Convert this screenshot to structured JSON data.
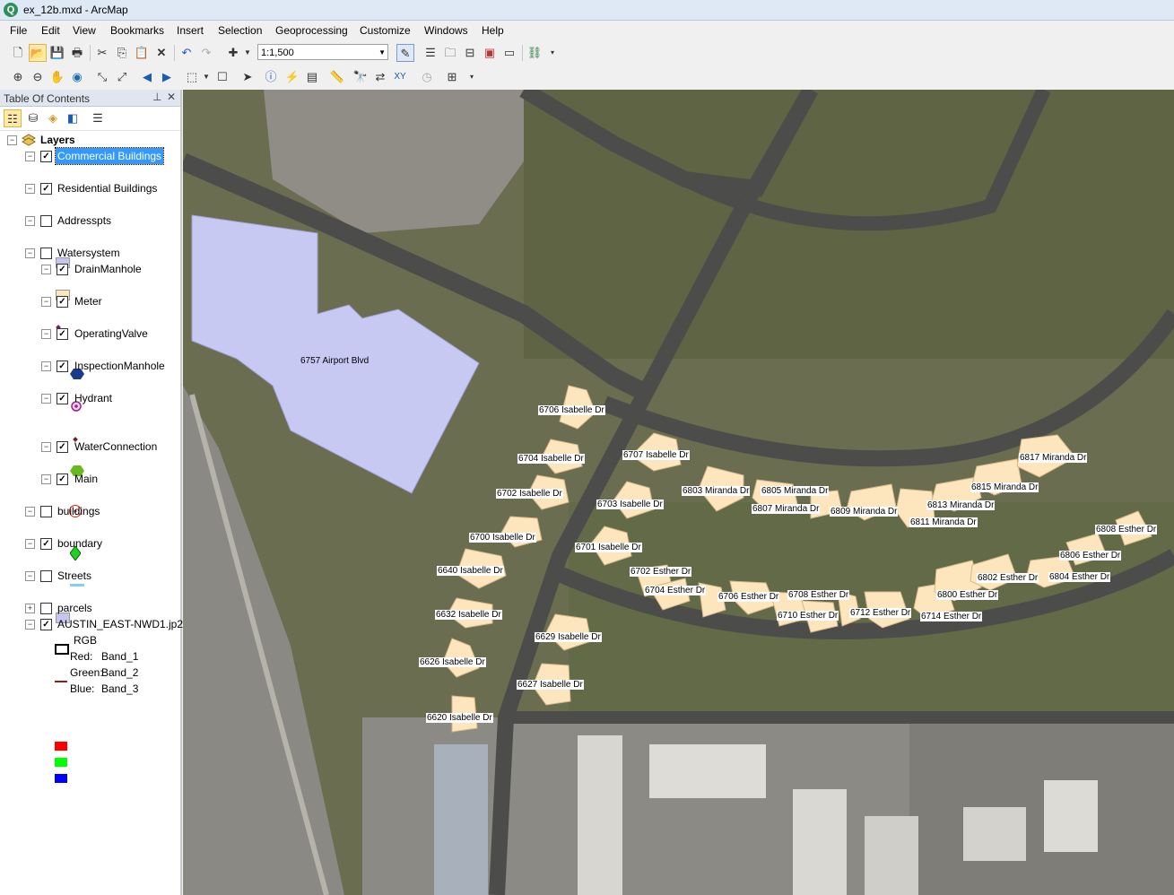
{
  "window": {
    "title": "ex_12b.mxd - ArcMap"
  },
  "menu": [
    "File",
    "Edit",
    "View",
    "Bookmarks",
    "Insert",
    "Selection",
    "Geoprocessing",
    "Customize",
    "Windows",
    "Help"
  ],
  "toolbar": {
    "scale": "1:1,500"
  },
  "toc": {
    "title": "Table Of Contents",
    "root": "Layers",
    "layers": [
      {
        "name": "Commercial Buildings",
        "checked": true
      },
      {
        "name": "Residential Buildings",
        "checked": true
      },
      {
        "name": "Addresspts",
        "checked": false
      },
      {
        "name": "Watersystem",
        "checked": false
      },
      {
        "name": "DrainManhole",
        "checked": true
      },
      {
        "name": "Meter",
        "checked": true
      },
      {
        "name": "OperatingValve",
        "checked": true
      },
      {
        "name": "InspectionManhole",
        "checked": true
      },
      {
        "name": "Hydrant",
        "checked": true
      },
      {
        "name": "WaterConnection",
        "checked": true
      },
      {
        "name": "Main",
        "checked": true
      },
      {
        "name": "buildings",
        "checked": false
      },
      {
        "name": "boundary",
        "checked": true
      },
      {
        "name": "Streets",
        "checked": false
      },
      {
        "name": "parcels",
        "checked": false
      },
      {
        "name": "AUSTIN_EAST-NWD1.jp2",
        "checked": true
      }
    ],
    "raster": {
      "rgb": "RGB",
      "bands": [
        {
          "label": "Red:",
          "band": "Band_1",
          "color": "#ff0000"
        },
        {
          "label": "Green:",
          "band": "Band_2",
          "color": "#00ff00"
        },
        {
          "label": "Blue:",
          "band": "Band_3",
          "color": "#0000ff"
        }
      ]
    }
  },
  "map": {
    "commercial_label": "6757 Airport Blvd",
    "addresses": [
      "6706 Isabelle Dr",
      "6704 Isabelle Dr",
      "6702 Isabelle Dr",
      "6700 Isabelle Dr",
      "6640 Isabelle Dr",
      "6632 Isabelle Dr",
      "6626 Isabelle Dr",
      "6620 Isabelle Dr",
      "6629 Isabelle Dr",
      "6627 Isabelle Dr",
      "6707 Isabelle Dr",
      "6703 Isabelle Dr",
      "6701 Isabelle Dr",
      "6803 Miranda Dr",
      "6805 Miranda Dr",
      "6807 Miranda Dr",
      "6809 Miranda Dr",
      "6811 Miranda Dr",
      "6813 Miranda Dr",
      "6815 Miranda Dr",
      "6817 Miranda Dr",
      "6702 Esther Dr",
      "6704 Esther Dr",
      "6706 Esther Dr",
      "6708 Esther Dr",
      "6710 Esther Dr",
      "6712 Esther Dr",
      "6714 Esther Dr",
      "6800 Esther Dr",
      "6802 Esther Dr",
      "6804 Esther Dr",
      "6806 Esther Dr",
      "6808 Esther Dr"
    ]
  }
}
